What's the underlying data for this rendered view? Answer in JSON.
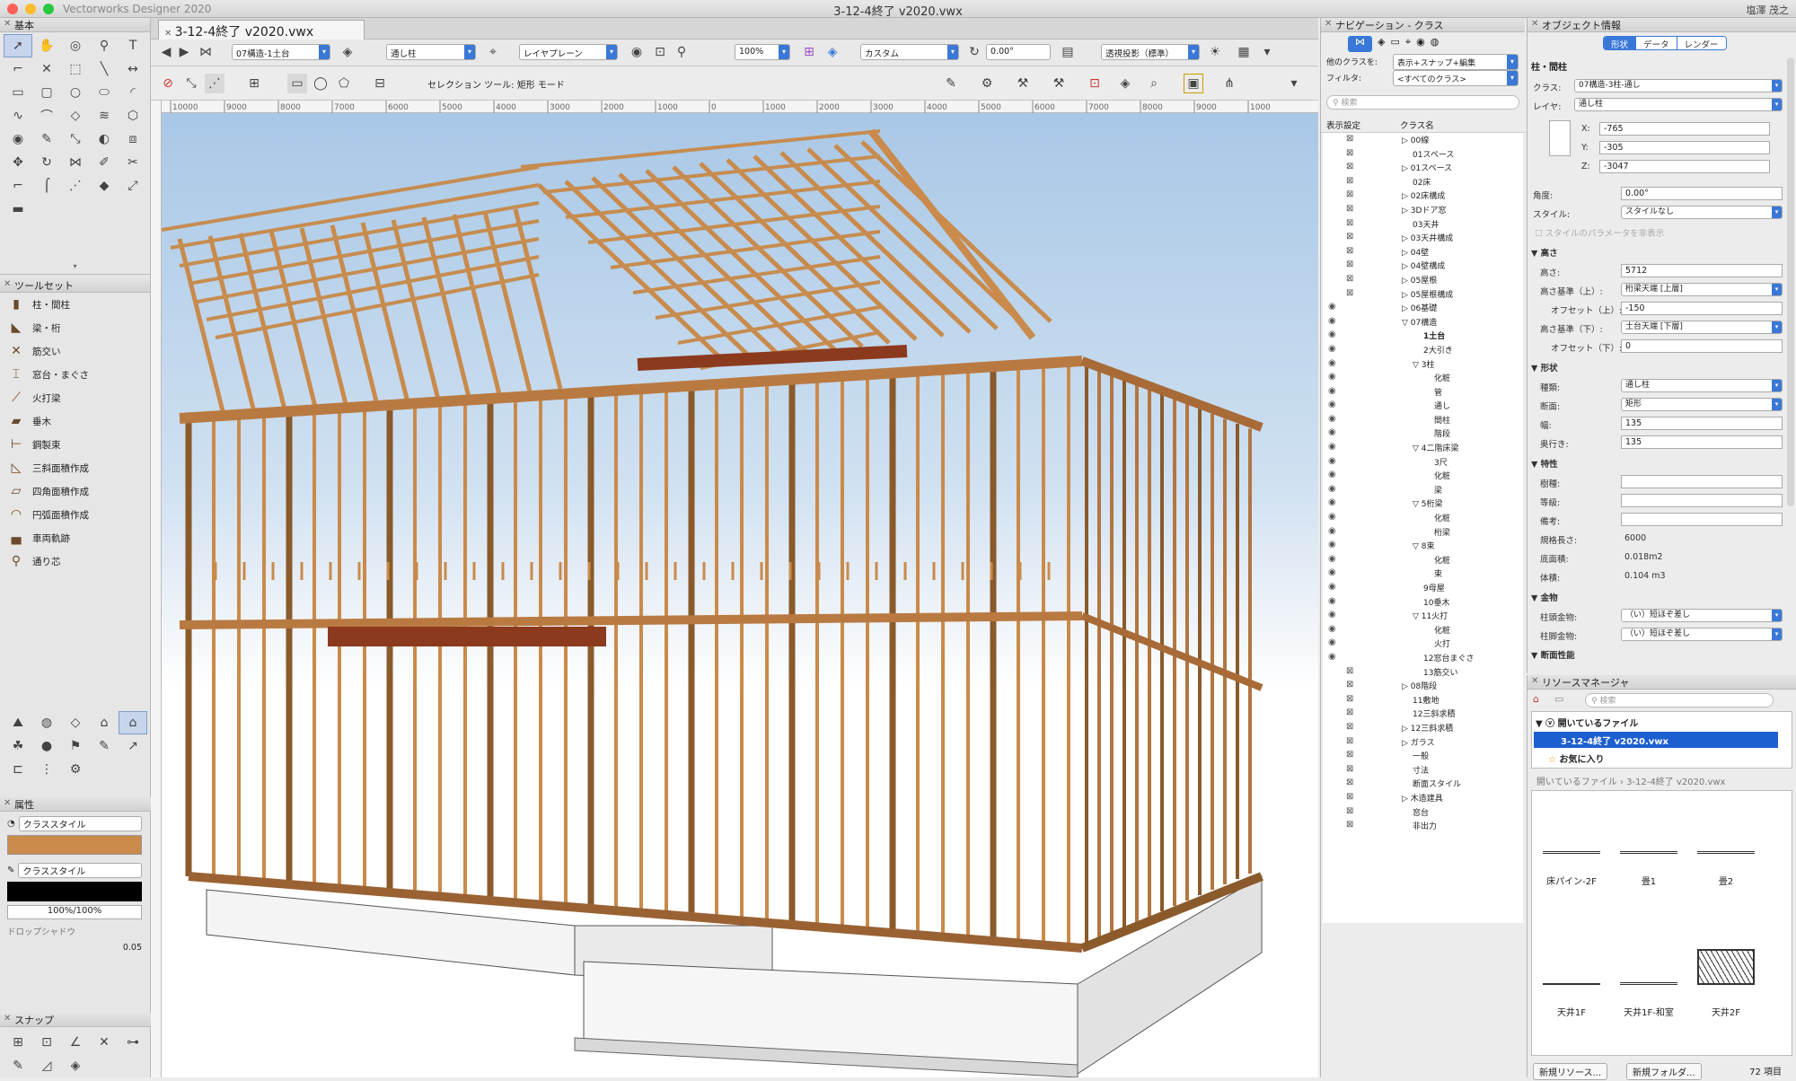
{
  "app": {
    "name": "Vectorworks Designer 2020",
    "document_title": "3-12-4終了 v2020.vwx",
    "user": "塩澤 茂之"
  },
  "left": {
    "basic_palette_title": "基本",
    "toolset_title": "ツールセット",
    "toolset_items": [
      "柱・間柱",
      "梁・桁",
      "筋交い",
      "窓台・まぐさ",
      "火打梁",
      "垂木",
      "鋼製束",
      "三斜面積作成",
      "四角面積作成",
      "円弧面積作成",
      "車両軌跡",
      "通り芯"
    ],
    "attributes_title": "属性",
    "fill_style": "クラススタイル",
    "pen_style": "クラススタイル",
    "opacity": "100%/100%",
    "drop_shadow": "ドロップシャドウ",
    "line_weight": "0.05",
    "snap_title": "スナップ"
  },
  "doc_tab": "3-12-4終了 v2020.vwx",
  "viewbar": {
    "active_class": "07構造-1土台",
    "active_layer": "通し柱",
    "layer_plane": "レイヤプレーン",
    "zoom": "100%",
    "view": "カスタム",
    "rotation": "0.00°",
    "projection": "透視投影（標準）"
  },
  "modebar": {
    "mode_text": "セレクション ツール: 矩形 モード"
  },
  "ruler_labels": [
    "10000",
    "9000",
    "8000",
    "7000",
    "6000",
    "5000",
    "4000",
    "3000",
    "2000",
    "1000",
    "0",
    "1000",
    "2000",
    "3000",
    "4000",
    "5000",
    "6000",
    "7000",
    "8000",
    "9000",
    "1000"
  ],
  "nav": {
    "title": "ナビゲーション - クラス",
    "other_class_label": "他のクラスを:",
    "other_class_value": "表示+スナップ+編集",
    "filter_label": "フィルタ:",
    "filter_value": "<すべてのクラス>",
    "search_placeholder": "検索",
    "col_visibility": "表示設定",
    "col_name": "クラス名",
    "classes": [
      {
        "name": "00線",
        "indent": 0,
        "expand": "▷",
        "vis": "x"
      },
      {
        "name": "01スペース",
        "indent": 1,
        "expand": "",
        "vis": "x"
      },
      {
        "name": "01スペース",
        "indent": 0,
        "expand": "▷",
        "vis": "x"
      },
      {
        "name": "02床",
        "indent": 1,
        "expand": "",
        "vis": "x"
      },
      {
        "name": "02床構成",
        "indent": 0,
        "expand": "▷",
        "vis": "x"
      },
      {
        "name": "3Dドア窓",
        "indent": 0,
        "expand": "▷",
        "vis": "x"
      },
      {
        "name": "03天井",
        "indent": 1,
        "expand": "",
        "vis": "x"
      },
      {
        "name": "03天井構成",
        "indent": 0,
        "expand": "▷",
        "vis": "x"
      },
      {
        "name": "04壁",
        "indent": 0,
        "expand": "▷",
        "vis": "x"
      },
      {
        "name": "04壁構成",
        "indent": 0,
        "expand": "▷",
        "vis": "x"
      },
      {
        "name": "05屋根",
        "indent": 0,
        "expand": "▷",
        "vis": "x"
      },
      {
        "name": "05屋根構成",
        "indent": 0,
        "expand": "▷",
        "vis": "x"
      },
      {
        "name": "06基礎",
        "indent": 0,
        "expand": "▷",
        "vis": "eye"
      },
      {
        "name": "07構造",
        "indent": 0,
        "expand": "▽",
        "vis": "eye"
      },
      {
        "name": "1土台",
        "indent": 2,
        "expand": "",
        "vis": "eye",
        "bold": true
      },
      {
        "name": "2大引き",
        "indent": 2,
        "expand": "",
        "vis": "eye"
      },
      {
        "name": "3柱",
        "indent": 1,
        "expand": "▽",
        "vis": "eye"
      },
      {
        "name": "化粧",
        "indent": 3,
        "expand": "",
        "vis": "eye"
      },
      {
        "name": "管",
        "indent": 3,
        "expand": "",
        "vis": "eye"
      },
      {
        "name": "通し",
        "indent": 3,
        "expand": "",
        "vis": "eye"
      },
      {
        "name": "間柱",
        "indent": 3,
        "expand": "",
        "vis": "eye"
      },
      {
        "name": "階段",
        "indent": 3,
        "expand": "",
        "vis": "eye"
      },
      {
        "name": "4二階床梁",
        "indent": 1,
        "expand": "▽",
        "vis": "eye"
      },
      {
        "name": "3尺",
        "indent": 3,
        "expand": "",
        "vis": "eye"
      },
      {
        "name": "化粧",
        "indent": 3,
        "expand": "",
        "vis": "eye"
      },
      {
        "name": "梁",
        "indent": 3,
        "expand": "",
        "vis": "eye"
      },
      {
        "name": "5桁梁",
        "indent": 1,
        "expand": "▽",
        "vis": "eye"
      },
      {
        "name": "化粧",
        "indent": 3,
        "expand": "",
        "vis": "eye"
      },
      {
        "name": "桁梁",
        "indent": 3,
        "expand": "",
        "vis": "eye"
      },
      {
        "name": "8束",
        "indent": 1,
        "expand": "▽",
        "vis": "eye"
      },
      {
        "name": "化粧",
        "indent": 3,
        "expand": "",
        "vis": "eye"
      },
      {
        "name": "束",
        "indent": 3,
        "expand": "",
        "vis": "eye"
      },
      {
        "name": "9母屋",
        "indent": 2,
        "expand": "",
        "vis": "eye"
      },
      {
        "name": "10垂木",
        "indent": 2,
        "expand": "",
        "vis": "eye"
      },
      {
        "name": "11火打",
        "indent": 1,
        "expand": "▽",
        "vis": "eye"
      },
      {
        "name": "化粧",
        "indent": 3,
        "expand": "",
        "vis": "eye"
      },
      {
        "name": "火打",
        "indent": 3,
        "expand": "",
        "vis": "eye"
      },
      {
        "name": "12窓台まぐさ",
        "indent": 2,
        "expand": "",
        "vis": "eye"
      },
      {
        "name": "13筋交い",
        "indent": 2,
        "expand": "",
        "vis": "x"
      },
      {
        "name": "08階段",
        "indent": 0,
        "expand": "▷",
        "vis": "x"
      },
      {
        "name": "11敷地",
        "indent": 1,
        "expand": "",
        "vis": "x"
      },
      {
        "name": "12三斜求積",
        "indent": 1,
        "expand": "",
        "vis": "x"
      },
      {
        "name": "12三斜求積",
        "indent": 0,
        "expand": "▷",
        "vis": "x"
      },
      {
        "name": "ガラス",
        "indent": 0,
        "expand": "▷",
        "vis": "x"
      },
      {
        "name": "一般",
        "indent": 1,
        "expand": "",
        "vis": "x"
      },
      {
        "name": "寸法",
        "indent": 1,
        "expand": "",
        "vis": "x"
      },
      {
        "name": "断面スタイル",
        "indent": 1,
        "expand": "",
        "vis": "x"
      },
      {
        "name": "木造建具",
        "indent": 0,
        "expand": "▷",
        "vis": "x"
      },
      {
        "name": "窓台",
        "indent": 1,
        "expand": "",
        "vis": "x"
      },
      {
        "name": "非出力",
        "indent": 1,
        "expand": "",
        "vis": "x"
      }
    ]
  },
  "oip": {
    "title": "オブジェクト情報",
    "tabs": [
      "形状",
      "データ",
      "レンダー"
    ],
    "object_type": "柱・間柱",
    "class_label": "クラス:",
    "class_value": "07構造-3柱-通し",
    "layer_label": "レイヤ:",
    "layer_value": "通し柱",
    "x_label": "X:",
    "x_value": "-765",
    "y_label": "Y:",
    "y_value": "-305",
    "z_label": "Z:",
    "z_value": "-3047",
    "angle_label": "角度:",
    "angle_value": "0.00°",
    "style_label": "スタイル:",
    "style_value": "スタイルなし",
    "style_param_hide": "スタイルのパラメータを非表示",
    "sec_height": "高さ",
    "height_label": "高さ:",
    "height_value": "5712",
    "top_base_label": "高さ基準（上）:",
    "top_base_value": "桁梁天端 [上層]",
    "top_offset_label": "オフセット（上）:",
    "top_offset_value": "-150",
    "bottom_base_label": "高さ基準（下）:",
    "bottom_base_value": "土台天端 [下層]",
    "bottom_offset_label": "オフセット（下）:",
    "bottom_offset_value": "0",
    "sec_shape": "形状",
    "kind_label": "種類:",
    "kind_value": "通し柱",
    "section_label": "断面:",
    "section_value": "矩形",
    "width_label": "幅:",
    "width_value": "135",
    "depth_label": "奥行き:",
    "depth_value": "135",
    "sec_props": "特性",
    "species_label": "樹種:",
    "species_value": "",
    "grade_label": "等級:",
    "grade_value": "",
    "note_label": "備考:",
    "note_value": "",
    "std_length_label": "規格長さ:",
    "std_length_value": "6000",
    "base_area_label": "底面積:",
    "base_area_value": "0.018m2",
    "volume_label": "体積:",
    "volume_value": "0.104 m3",
    "sec_hardware": "金物",
    "head_hw_label": "柱頭金物:",
    "head_hw_value": "（い）短ほぞ差し",
    "foot_hw_label": "柱脚金物:",
    "foot_hw_value": "（い）短ほぞ差し",
    "sec_section": "断面性能"
  },
  "res": {
    "title": "リソースマネージャ",
    "search_placeholder": "検索",
    "tree_open_files": "開いているファイル",
    "tree_current_file": "3-12-4終了 v2020.vwx",
    "tree_favorites": "お気に入り",
    "crumb_1": "開いているファイル",
    "crumb_2": "3-12-4終了 v2020.vwx",
    "items": [
      "床パイン-2F",
      "畳1",
      "畳2",
      "天井1F",
      "天井1F-和室",
      "天井2F"
    ],
    "new_resource": "新規リソース...",
    "new_folder": "新規フォルダ...",
    "count": "72 項目"
  },
  "colors": {
    "accent": "#3a78d8",
    "wood": "#c98a4b",
    "wood_dark": "#8a5a2b",
    "beam_red": "#8b3a1e",
    "sky": "#a9c8e6"
  }
}
